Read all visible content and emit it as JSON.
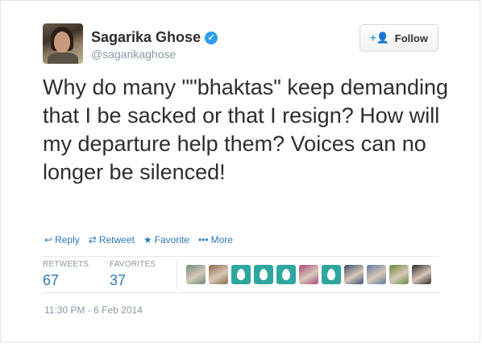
{
  "user": {
    "name": "Sagarika Ghose",
    "handle": "@sagarikaghose",
    "verified_mark": "✓"
  },
  "follow_button": {
    "icon": "person-plus-icon",
    "icon_glyph": "+👤",
    "label": "Follow"
  },
  "tweet": {
    "text": "Why do many \"\"bhaktas\" keep demanding that I be sacked or that I resign? How will my departure help them? Voices can no longer be silenced!",
    "timestamp": "11:30 PM - 6 Feb 2014"
  },
  "actions": [
    {
      "name": "reply",
      "icon": "reply-icon",
      "glyph": "↩",
      "label": "Reply"
    },
    {
      "name": "retweet",
      "icon": "retweet-icon",
      "glyph": "⇄",
      "label": "Retweet"
    },
    {
      "name": "favorite",
      "icon": "star-icon",
      "glyph": "★",
      "label": "Favorite"
    },
    {
      "name": "more",
      "icon": "more-icon",
      "glyph": "•••",
      "label": "More"
    }
  ],
  "stats": {
    "retweets_label": "RETWEETS",
    "retweets_value": "67",
    "favorites_label": "FAVORITES",
    "favorites_value": "37"
  },
  "favoriters": [
    {
      "kind": "photo",
      "color": "#6d8a7a"
    },
    {
      "kind": "photo",
      "color": "#8a6a4a"
    },
    {
      "kind": "egg",
      "color": "#2fa79f"
    },
    {
      "kind": "egg",
      "color": "#2fa79f"
    },
    {
      "kind": "egg",
      "color": "#2fa79f"
    },
    {
      "kind": "photo",
      "color": "#a84a7a"
    },
    {
      "kind": "egg",
      "color": "#2fa79f"
    },
    {
      "kind": "photo",
      "color": "#3a4a6a"
    },
    {
      "kind": "photo",
      "color": "#5a7a9a"
    },
    {
      "kind": "photo",
      "color": "#6a8a3a"
    },
    {
      "kind": "photo",
      "color": "#2a2a2a"
    }
  ],
  "colors": {
    "link": "#2b7bb9",
    "muted": "#8899a6",
    "verified": "#2b9ff0",
    "egg": "#2fa79f"
  }
}
